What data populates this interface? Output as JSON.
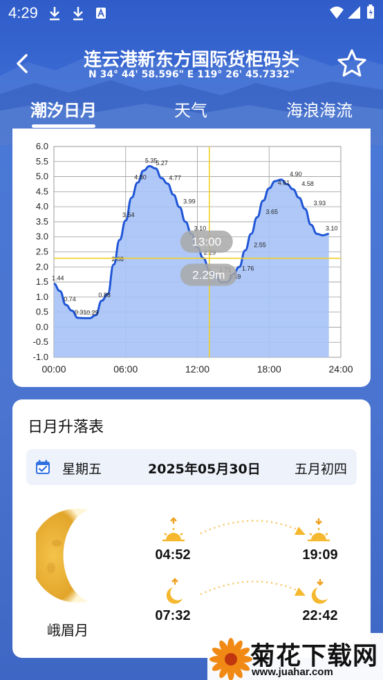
{
  "status_bar": {
    "time": "4:29"
  },
  "header": {
    "title": "连云港新东方国际货柜码头",
    "coords": "N 34° 44' 58.596\"  E 119° 26' 45.7332\""
  },
  "tabs": [
    {
      "label": "潮汐日月",
      "active": true
    },
    {
      "label": "天气",
      "active": false
    },
    {
      "label": "海浪海流",
      "active": false
    }
  ],
  "chart_data": {
    "type": "area",
    "x_ticks": [
      "00:00",
      "06:00",
      "12:00",
      "18:00",
      "24:00"
    ],
    "y_ticks": [
      "6.0",
      "5.5",
      "5.0",
      "4.5",
      "4.0",
      "3.5",
      "3.0",
      "2.5",
      "2.0",
      "1.5",
      "1.0",
      "0.5",
      "0.0",
      "-0.5",
      "-1.0"
    ],
    "ylim": [
      -1.0,
      6.0
    ],
    "xlim_hours": [
      0,
      24
    ],
    "series": [
      {
        "x_hours": [
          0,
          0.5,
          1,
          1.5,
          2,
          2.5,
          3,
          3.5,
          4,
          4.5,
          5,
          5.5,
          6,
          6.5,
          7,
          7.5,
          8,
          8.5,
          9,
          9.5,
          10,
          10.5,
          11,
          11.5,
          12,
          12.5,
          13,
          13.5,
          14,
          14.5,
          15,
          15.5,
          16,
          16.5,
          17,
          17.5,
          18,
          18.5,
          19,
          19.5,
          20,
          20.5,
          21,
          21.5,
          22,
          22.5,
          23
        ],
        "y": [
          1.44,
          1.2,
          0.74,
          0.55,
          0.31,
          0.3,
          0.3,
          0.4,
          0.88,
          1.1,
          2.08,
          2.9,
          3.54,
          4.3,
          4.8,
          5.2,
          5.35,
          5.27,
          4.95,
          4.77,
          4.4,
          3.99,
          3.5,
          3.1,
          2.65,
          2.29,
          1.9,
          1.71,
          1.49,
          1.5,
          1.76,
          2.0,
          2.55,
          3.1,
          3.65,
          4.2,
          4.61,
          4.85,
          4.9,
          4.75,
          4.58,
          4.3,
          3.93,
          3.4,
          3.1,
          3.05,
          3.1
        ]
      }
    ],
    "point_labels": [
      {
        "x": 0.1,
        "y": 1.44,
        "text": "1.44"
      },
      {
        "x": 1.1,
        "y": 0.74,
        "text": "0.74"
      },
      {
        "x": 2.0,
        "y": 0.31,
        "text": "0.31"
      },
      {
        "x": 3.0,
        "y": 0.3,
        "text": "0.29"
      },
      {
        "x": 4.0,
        "y": 0.88,
        "text": "0.88"
      },
      {
        "x": 5.1,
        "y": 2.08,
        "text": "2.08"
      },
      {
        "x": 6.0,
        "y": 3.54,
        "text": "3.54"
      },
      {
        "x": 7.0,
        "y": 4.8,
        "text": "4.80"
      },
      {
        "x": 7.9,
        "y": 5.35,
        "text": "5.35"
      },
      {
        "x": 8.8,
        "y": 5.27,
        "text": "5.27"
      },
      {
        "x": 9.9,
        "y": 4.77,
        "text": "4.77"
      },
      {
        "x": 11.1,
        "y": 3.99,
        "text": "3.99"
      },
      {
        "x": 12.0,
        "y": 3.1,
        "text": "3.10"
      },
      {
        "x": 12.8,
        "y": 2.29,
        "text": "2.29"
      },
      {
        "x": 14.1,
        "y": 1.71,
        "text": "1.71"
      },
      {
        "x": 14.9,
        "y": 1.49,
        "text": "1.49"
      },
      {
        "x": 16.0,
        "y": 1.76,
        "text": "1.76"
      },
      {
        "x": 17.0,
        "y": 2.55,
        "text": "2.55"
      },
      {
        "x": 18.0,
        "y": 3.65,
        "text": "3.65"
      },
      {
        "x": 19.0,
        "y": 4.61,
        "text": "4.61"
      },
      {
        "x": 20.0,
        "y": 4.9,
        "text": "4.90"
      },
      {
        "x": 21.0,
        "y": 4.58,
        "text": "4.58"
      },
      {
        "x": 22.0,
        "y": 3.93,
        "text": "3.93"
      },
      {
        "x": 23.0,
        "y": 3.1,
        "text": "3.10"
      }
    ],
    "crosshair": {
      "x_hours": 13.0,
      "y": 2.29,
      "time_label": "13:00",
      "value_label": "2.29m"
    },
    "grid": true,
    "colors": {
      "line": "#1f55d6",
      "fill": "#a6c2f6",
      "crosshair": "#f2d027"
    }
  },
  "sun_moon": {
    "title": "日月升落表",
    "weekday": "星期五",
    "date": "2025年05月30日",
    "lunar_date": "五月初四",
    "moon_phase": "峨眉月",
    "sunrise": "04:52",
    "sunset": "19:09",
    "moonrise": "07:32",
    "moonset": "22:42"
  },
  "watermark": {
    "brand": "菊花下载网",
    "url": "www.juahar.com"
  }
}
